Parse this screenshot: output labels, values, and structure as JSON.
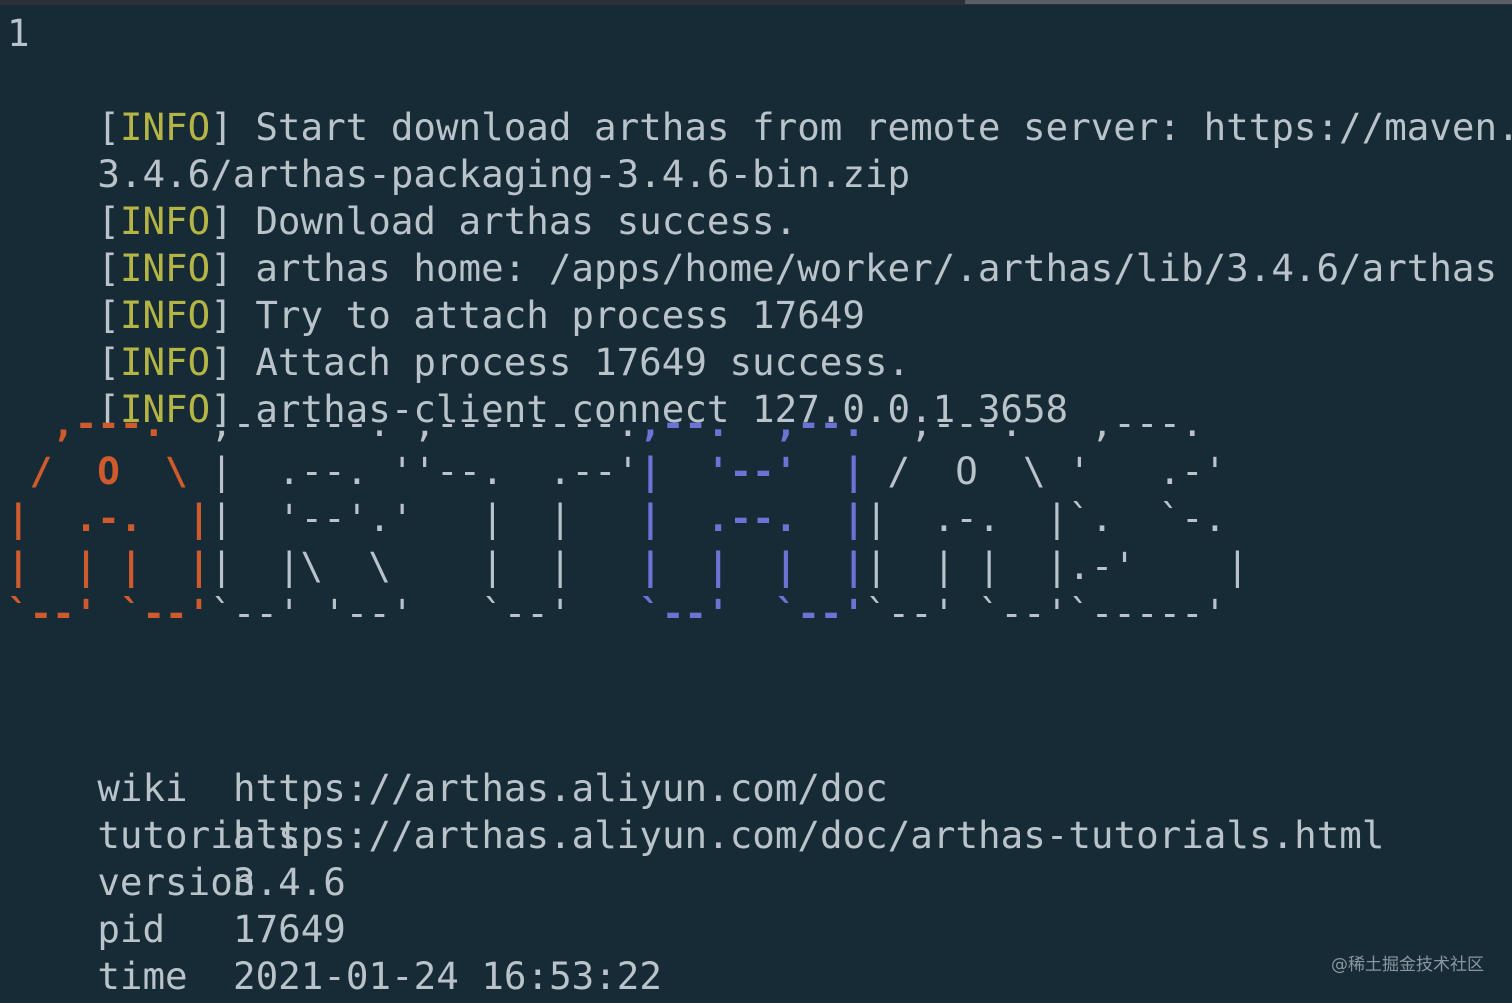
{
  "terminal": {
    "prompt_line": "1",
    "log_lines": [
      {
        "level": "INFO",
        "message": "Start download arthas from remote server: https://maven.aliy"
      },
      {
        "level": "",
        "message": "3.4.6/arthas-packaging-3.4.6-bin.zip"
      },
      {
        "level": "INFO",
        "message": "Download arthas success."
      },
      {
        "level": "INFO",
        "message": "arthas home: /apps/home/worker/.arthas/lib/3.4.6/arthas"
      },
      {
        "level": "INFO",
        "message": "Try to attach process 17649"
      },
      {
        "level": "INFO",
        "message": "Attach process 17649 success."
      },
      {
        "level": "INFO",
        "message": "arthas-client connect 127.0.0.1 3658"
      }
    ],
    "banner": {
      "rows": [
        [
          {
            "t": "  ,---.  ",
            "c": "red"
          },
          {
            "t": ",------. ,--------.",
            "c": "gray"
          },
          {
            "t": ",--.  ,--.",
            "c": "blue"
          },
          {
            "t": "  ,---.   ,---.",
            "c": "gray"
          }
        ],
        [
          {
            "t": " /  O  \\ ",
            "c": "red"
          },
          {
            "t": "|  .--. ''--.  .--'",
            "c": "gray"
          },
          {
            "t": "|  '--'  |",
            "c": "blue"
          },
          {
            "t": " /  O  \\ '   .-'",
            "c": "gray"
          }
        ],
        [
          {
            "t": "|  .-.  |",
            "c": "red"
          },
          {
            "t": "|  '--'.'   |  |   ",
            "c": "gray"
          },
          {
            "t": "|  .--.  |",
            "c": "blue"
          },
          {
            "t": "|  .-.  |`.  `-.",
            "c": "gray"
          }
        ],
        [
          {
            "t": "|  | |  |",
            "c": "red"
          },
          {
            "t": "|  |\\  \\    |  |   ",
            "c": "gray"
          },
          {
            "t": "|  |  |  |",
            "c": "blue"
          },
          {
            "t": "|  | |  |.-'    |",
            "c": "gray"
          }
        ],
        [
          {
            "t": "`--' `--'",
            "c": "red"
          },
          {
            "t": "`--' '--'   `--'   ",
            "c": "gray"
          },
          {
            "t": "`--'  `--'",
            "c": "blue"
          },
          {
            "t": "`--' `--'`-----'",
            "c": "gray"
          }
        ]
      ]
    },
    "info_table": [
      {
        "label": "wiki",
        "value": "https://arthas.aliyun.com/doc"
      },
      {
        "label": "tutorials",
        "value": "https://arthas.aliyun.com/doc/arthas-tutorials.html"
      },
      {
        "label": "version",
        "value": "3.4.6"
      },
      {
        "label": "pid",
        "value": "17649"
      },
      {
        "label": "time",
        "value": "2021-01-24 16:53:22"
      }
    ]
  },
  "watermark": "@稀土掘金技术社区",
  "colors": {
    "background": "#172b36",
    "text": "#b9c3c9",
    "info_tag": "#b5b546",
    "banner_red": "#cf5a2c",
    "banner_blue": "#6b73d4"
  }
}
